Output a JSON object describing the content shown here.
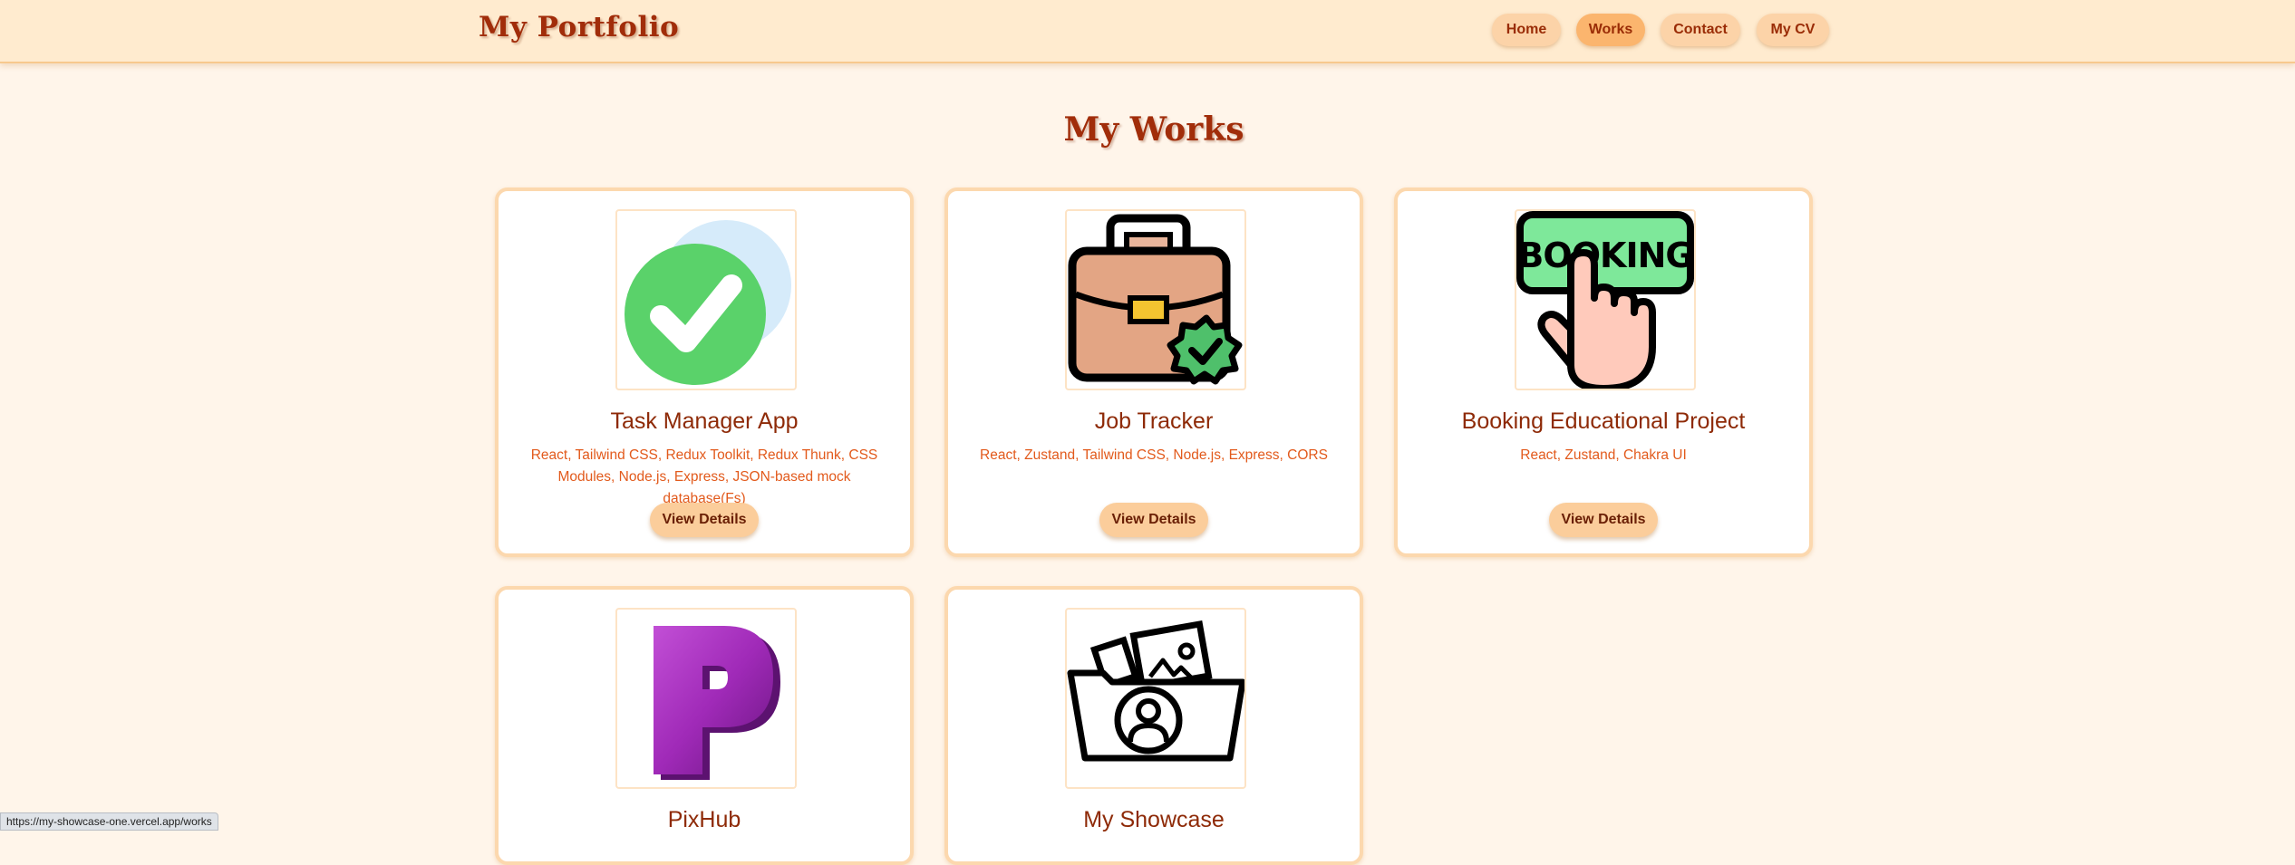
{
  "header": {
    "brand": "My Portfolio",
    "nav": [
      {
        "label": "Home",
        "active": false
      },
      {
        "label": "Works",
        "active": true
      },
      {
        "label": "Contact",
        "active": false
      },
      {
        "label": "My CV",
        "active": false
      }
    ]
  },
  "main": {
    "title": "My Works",
    "projects": [
      {
        "title": "Task Manager App",
        "tech": "React, Tailwind CSS, Redux Toolkit, Redux Thunk, CSS Modules, Node.js, Express, JSON-based mock database(Fs)",
        "button": "View Details",
        "icon": "check-circle-icon"
      },
      {
        "title": "Job Tracker",
        "tech": "React, Zustand, Tailwind CSS, Node.js, Express, CORS",
        "button": "View Details",
        "icon": "briefcase-icon"
      },
      {
        "title": "Booking Educational Project",
        "tech": "React, Zustand, Chakra UI",
        "button": "View Details",
        "icon": "booking-hand-icon"
      },
      {
        "title": "PixHub",
        "tech": "",
        "button": "",
        "icon": "letter-p-icon"
      },
      {
        "title": "My Showcase",
        "tech": "",
        "button": "",
        "icon": "profile-folder-icon"
      }
    ]
  },
  "status_bar": {
    "url": "https://my-showcase-one.vercel.app/works"
  },
  "colors": {
    "background": "#fff5ea",
    "header": "#ffebcf",
    "accent": "#a12d0a",
    "button": "#fbcd9b",
    "active_nav": "#fbb56e"
  }
}
